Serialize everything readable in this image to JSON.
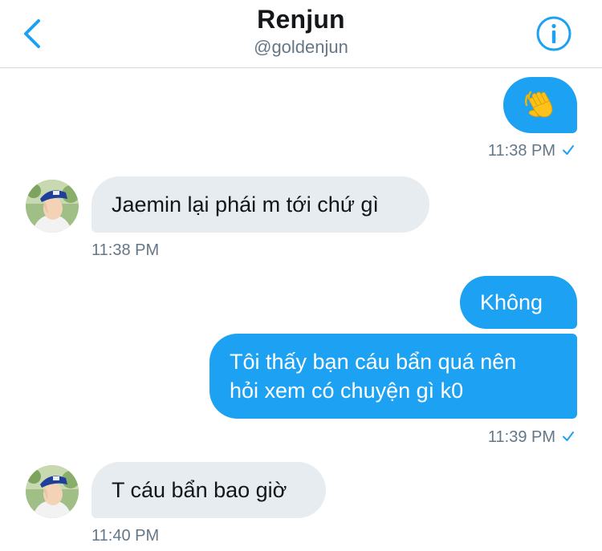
{
  "header": {
    "title": "Renjun",
    "handle": "@goldenjun",
    "back_icon": "chevron-left-icon",
    "info_icon": "info-icon"
  },
  "colors": {
    "accent": "#1da1f2",
    "received_bubble": "#e6ecf0",
    "timestamp": "#657786"
  },
  "messages": [
    {
      "direction": "sent",
      "text": "👋",
      "emoji": "waving-hand"
    },
    {
      "direction": "sent",
      "time": "11:38 PM",
      "read_check": "checkmark-icon"
    },
    {
      "direction": "received",
      "text": "Jaemin lại phái m tới chứ gì",
      "time": "11:38 PM"
    },
    {
      "direction": "sent",
      "text": "Không"
    },
    {
      "direction": "sent",
      "line1": "Tôi thấy bạn cáu bẩn quá nên",
      "line2": "hỏi xem có chuyện gì k0",
      "time": "11:39 PM",
      "read_check": "checkmark-icon"
    },
    {
      "direction": "received",
      "text": "T cáu bẩn bao giờ",
      "time": "11:40 PM"
    }
  ]
}
